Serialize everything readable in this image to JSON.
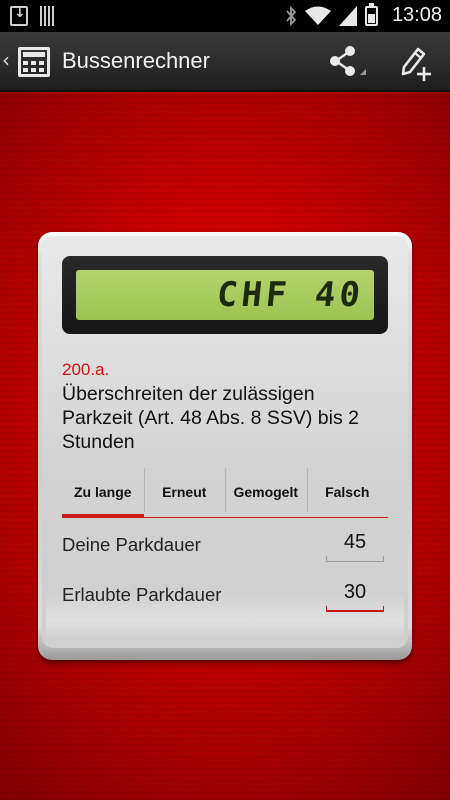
{
  "status_bar": {
    "time": "13:08",
    "icons": [
      "download-notification-icon",
      "barcode-notification-icon",
      "bluetooth-icon",
      "wifi-icon",
      "signal-icon",
      "battery-icon"
    ]
  },
  "action_bar": {
    "title": "Bussenrechner",
    "back_glyph": "‹",
    "app_icon": "calculator-icon",
    "actions": [
      "share-icon",
      "edit-add-icon"
    ]
  },
  "calculator": {
    "display": "CHF 40",
    "offense_code": "200.a.",
    "offense_description": "Überschreiten der zulässigen Parkzeit (Art. 48 Abs. 8 SSV) bis 2 Stunden",
    "tabs": [
      {
        "label": "Zu lange",
        "active": true
      },
      {
        "label": "Erneut",
        "active": false
      },
      {
        "label": "Gemogelt",
        "active": false
      },
      {
        "label": "Falsch",
        "active": false
      }
    ],
    "fields": [
      {
        "label": "Deine Parkdauer",
        "value": "45",
        "focused": false
      },
      {
        "label": "Erlaubte Parkdauer",
        "value": "30",
        "focused": true
      }
    ]
  },
  "colors": {
    "accent": "#c81818",
    "lcd_background": "#a8c95d",
    "background_red": "#c00000"
  }
}
